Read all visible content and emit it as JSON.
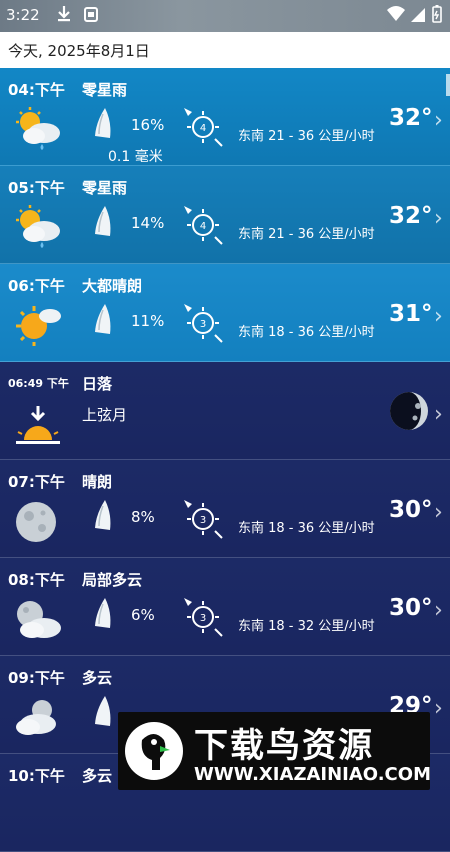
{
  "status_bar": {
    "time": "3:22"
  },
  "date_header": "今天, 2025年8月1日",
  "rows": [
    {
      "hour": "04:下午",
      "condition": "零星雨",
      "precip": "16%",
      "amount": "0.1 毫米",
      "wind_level": "4",
      "wind": "东南 21 - 36 公里/小时",
      "temp": "32°"
    },
    {
      "hour": "05:下午",
      "condition": "零星雨",
      "precip": "14%",
      "wind_level": "4",
      "wind": "东南 21 - 36 公里/小时",
      "temp": "32°"
    },
    {
      "hour": "06:下午",
      "condition": "大都晴朗",
      "precip": "11%",
      "wind_level": "3",
      "wind": "东南 18 - 36 公里/小时",
      "temp": "31°"
    },
    {
      "hour": "06:49 下午",
      "condition": "日落",
      "subtitle": "上弦月"
    },
    {
      "hour": "07:下午",
      "condition": "晴朗",
      "precip": "8%",
      "wind_level": "3",
      "wind": "东南 18 - 36 公里/小时",
      "temp": "30°"
    },
    {
      "hour": "08:下午",
      "condition": "局部多云",
      "precip": "6%",
      "wind_level": "3",
      "wind": "东南 18 - 32 公里/小时",
      "temp": "30°"
    },
    {
      "hour": "09:下午",
      "condition": "多云",
      "temp": "29°"
    },
    {
      "hour": "10:下午",
      "condition": "多云"
    }
  ],
  "watermark": {
    "title": "下载鸟资源",
    "url": "WWW.XIAZAINIAO.COM"
  }
}
